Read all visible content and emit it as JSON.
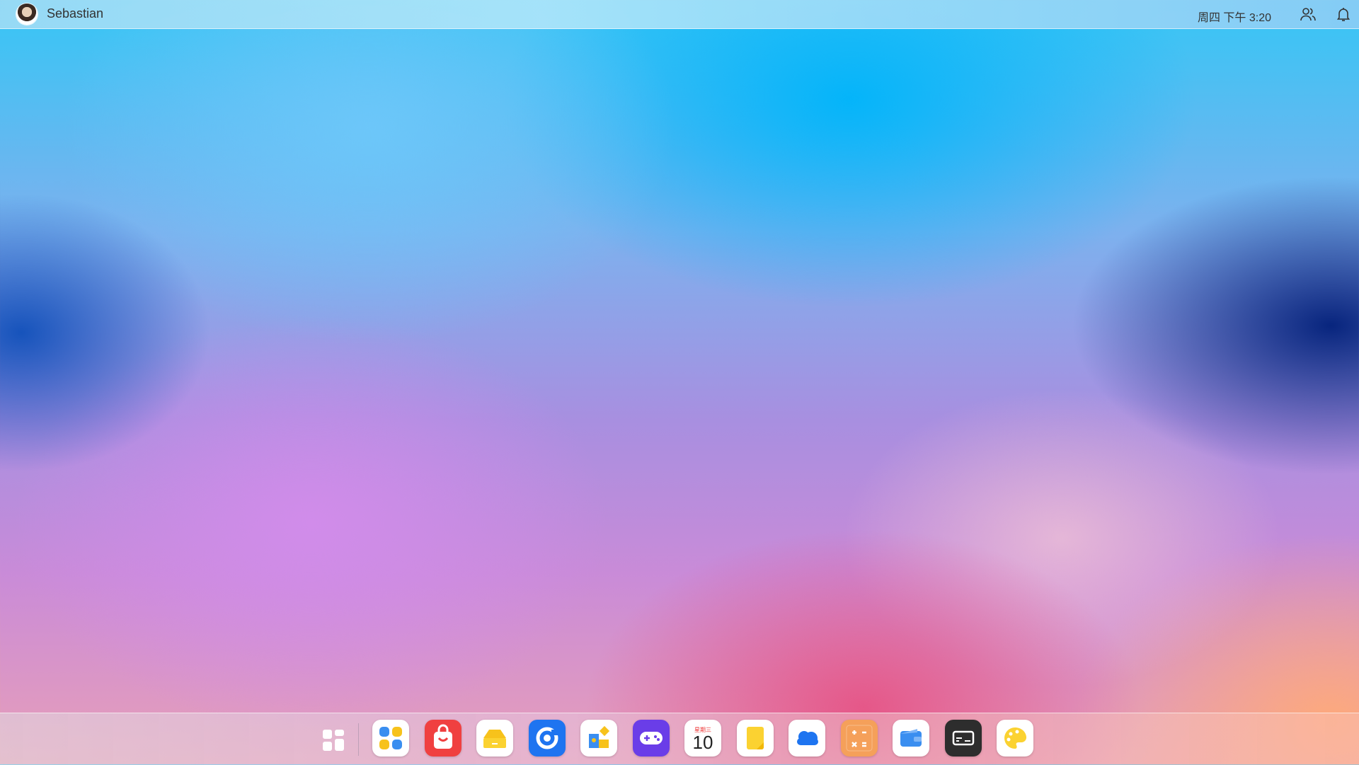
{
  "topbar": {
    "user_name": "Sebastian",
    "clock": "周四 下午 3:20",
    "icons": [
      "avatar",
      "contacts-icon",
      "bell-icon"
    ]
  },
  "dock": {
    "launcher_icon": "grid-launcher-icon",
    "apps": [
      {
        "name": "app-store",
        "icon": "four-dots-icon"
      },
      {
        "name": "shop",
        "icon": "shopping-bag-icon"
      },
      {
        "name": "files",
        "icon": "folder-icon"
      },
      {
        "name": "browser",
        "icon": "browser-ring-icon"
      },
      {
        "name": "puzzle",
        "icon": "puzzle-icon"
      },
      {
        "name": "games",
        "icon": "gamepad-icon"
      },
      {
        "name": "calendar",
        "icon": "calendar-icon",
        "weekday": "星期三",
        "date": "10"
      },
      {
        "name": "notes",
        "icon": "note-icon"
      },
      {
        "name": "cloud",
        "icon": "cloud-icon"
      },
      {
        "name": "calculator",
        "icon": "calculator-icon"
      },
      {
        "name": "wallet",
        "icon": "wallet-icon"
      },
      {
        "name": "terminal",
        "icon": "terminal-icon"
      },
      {
        "name": "paint",
        "icon": "palette-icon"
      }
    ]
  }
}
